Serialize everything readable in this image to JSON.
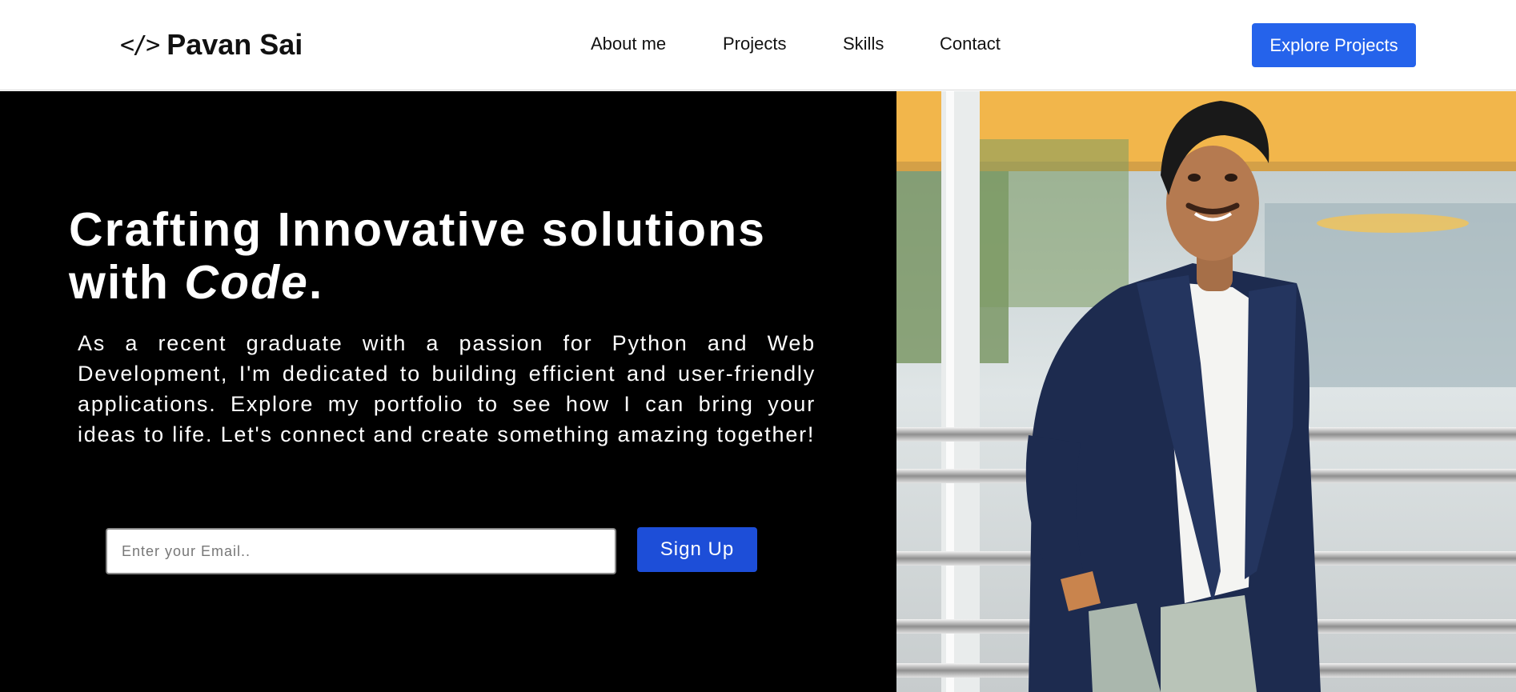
{
  "brand": {
    "icon_name": "code-icon",
    "icon_glyph": "</>",
    "name": "Pavan Sai"
  },
  "nav": {
    "links": [
      "About me",
      "Projects",
      "Skills",
      "Contact"
    ],
    "cta_label": "Explore Projects"
  },
  "hero": {
    "headline_line1": "Crafting Innovative solutions",
    "headline_line2_prefix": "with ",
    "headline_emphasis": "Code",
    "headline_suffix": ".",
    "intro": "As a recent graduate with a passion for Python and Web Development, I'm dedicated to building efficient and user-friendly applications. Explore my portfolio to see how I can bring your ideas to life. Let's connect and create something amazing together!",
    "email_placeholder": "Enter your Email..",
    "email_value": "",
    "signup_label": "Sign Up"
  },
  "colors": {
    "accent": "#2563eb",
    "signup": "#1d4ed8",
    "hero_bg": "#000000"
  }
}
